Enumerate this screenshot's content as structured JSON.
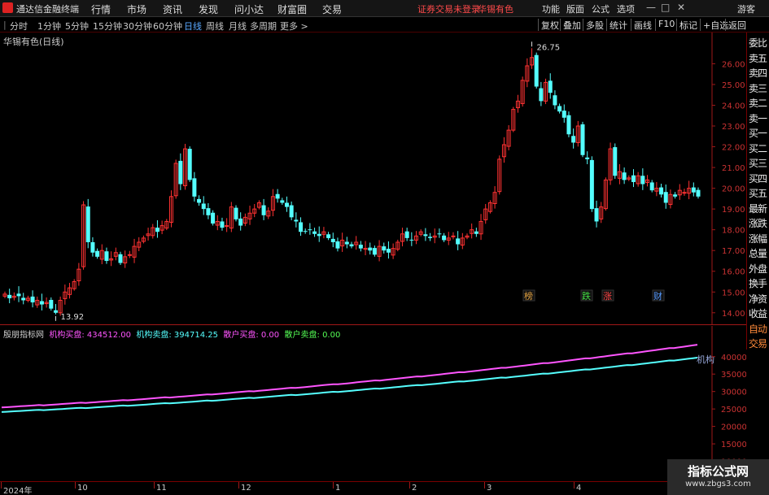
{
  "app": {
    "title": "通达信金融终端"
  },
  "menu": [
    "行情",
    "市场",
    "资讯",
    "发现",
    "问小达",
    "财富圈",
    "交易"
  ],
  "login_notice": "证券交易未登录",
  "stock_name": "华锡有色",
  "right_menu": [
    "功能",
    "版面",
    "公式",
    "选项"
  ],
  "user": "游客",
  "window_buttons": [
    "—",
    "□",
    "✕"
  ],
  "periods": [
    "分时",
    "1分钟",
    "5分钟",
    "15分钟",
    "30分钟",
    "60分钟",
    "日线",
    "周线",
    "月线",
    "多周期",
    "更多 >"
  ],
  "active_period": "日线",
  "toolbar_buttons": [
    "复权",
    "叠加",
    "多股",
    "统计",
    "画线",
    "F10",
    "标记",
    "+自选",
    "返回"
  ],
  "chart_title": "华锡有色(日线)",
  "kline": {
    "y_ticks": [
      "26.00",
      "25.00",
      "24.00",
      "23.00",
      "22.00",
      "21.00",
      "20.00",
      "19.00",
      "18.00",
      "17.00",
      "16.00",
      "15.00",
      "14.00"
    ],
    "ymin": 13.6,
    "ymax": 26.8,
    "high_label": "26.75",
    "low_label": "13.92",
    "high": 26.75,
    "low": 13.92,
    "colors": {
      "up": "#ff3232",
      "down": "#54ffff",
      "axis": "#a01818",
      "tick": "#cc3333"
    },
    "events": [
      {
        "label": "榜",
        "color": "#e0a040"
      },
      {
        "label": "跌",
        "color": "#44dd44"
      },
      {
        "label": "涨",
        "color": "#ff4444"
      },
      {
        "label": "财",
        "color": "#5599ff"
      }
    ],
    "closes": [
      14.9,
      14.7,
      14.8,
      14.8,
      14.6,
      14.7,
      14.5,
      14.6,
      14.4,
      14.5,
      14.2,
      14.0,
      14.6,
      15.0,
      15.2,
      15.5,
      16.1,
      19.2,
      17.4,
      16.9,
      16.7,
      17.0,
      16.5,
      16.6,
      16.9,
      16.4,
      16.7,
      16.8,
      17.2,
      17.4,
      17.6,
      17.8,
      18.1,
      17.9,
      18.2,
      18.4,
      19.6,
      21.2,
      20.2,
      21.9,
      20.4,
      19.6,
      19.3,
      19.0,
      18.7,
      18.3,
      18.4,
      18.1,
      18.2,
      19.1,
      18.5,
      18.2,
      18.6,
      18.8,
      19.0,
      19.3,
      18.7,
      18.9,
      19.6,
      19.5,
      19.3,
      19.1,
      18.6,
      18.4,
      17.9,
      17.9,
      18.0,
      17.8,
      17.7,
      17.9,
      17.6,
      17.4,
      17.1,
      17.5,
      17.3,
      17.2,
      17.4,
      17.1,
      17.1,
      17.0,
      16.8,
      17.2,
      17.0,
      16.9,
      17.1,
      17.4,
      17.8,
      17.6,
      17.5,
      17.7,
      17.9,
      17.7,
      17.6,
      17.7,
      17.8,
      17.5,
      17.6,
      17.7,
      17.3,
      17.6,
      17.7,
      18.0,
      17.8,
      18.4,
      19.0,
      19.3,
      19.8,
      21.4,
      22.1,
      22.8,
      23.8,
      24.2,
      25.2,
      25.9,
      26.3,
      24.9,
      24.2,
      25.1,
      24.6,
      24.0,
      23.7,
      23.4,
      22.6,
      22.2,
      23.0,
      21.6,
      21.4,
      19.0,
      18.4,
      19.1,
      20.4,
      21.9,
      20.6,
      20.8,
      20.4,
      20.5,
      20.3,
      20.6,
      20.2,
      20.4,
      19.9,
      20.0,
      19.7,
      19.3,
      19.7,
      19.6,
      19.9,
      19.8,
      20.0,
      19.8,
      19.6
    ]
  },
  "indicator": {
    "name": "殷朋指标网",
    "items": [
      {
        "label": "机构买盘: 434512.00",
        "color": "#ff55ff"
      },
      {
        "label": "机构卖盘: 394714.25",
        "color": "#55ffff"
      },
      {
        "label": "散户买盘: 0.00",
        "color": "#ff55ff"
      },
      {
        "label": "散户卖盘: 0.00",
        "color": "#55ff55"
      }
    ],
    "line_tag": "机构",
    "y_ticks": [
      "40000",
      "35000",
      "30000",
      "25000",
      "20000",
      "15000",
      "10000"
    ],
    "ymin": 5000,
    "ymax": 46000,
    "buy_start": 25500,
    "buy_end": 43400,
    "sell_start": 24200,
    "sell_end": 39700
  },
  "sidebar": [
    "委比",
    "卖五",
    "卖四",
    "卖三",
    "卖二",
    "卖一",
    "买一",
    "买二",
    "买三",
    "买四",
    "买五",
    "最新",
    "涨跌",
    "涨幅",
    "总量",
    "外盘",
    "换手",
    "净资",
    "收益",
    "自动",
    "交易"
  ],
  "dates": [
    "2024年",
    "10",
    "11",
    "12",
    "1",
    "2",
    "3",
    "4"
  ],
  "watermark": {
    "title": "指标公式网",
    "url": "www.zbgs3.com"
  }
}
